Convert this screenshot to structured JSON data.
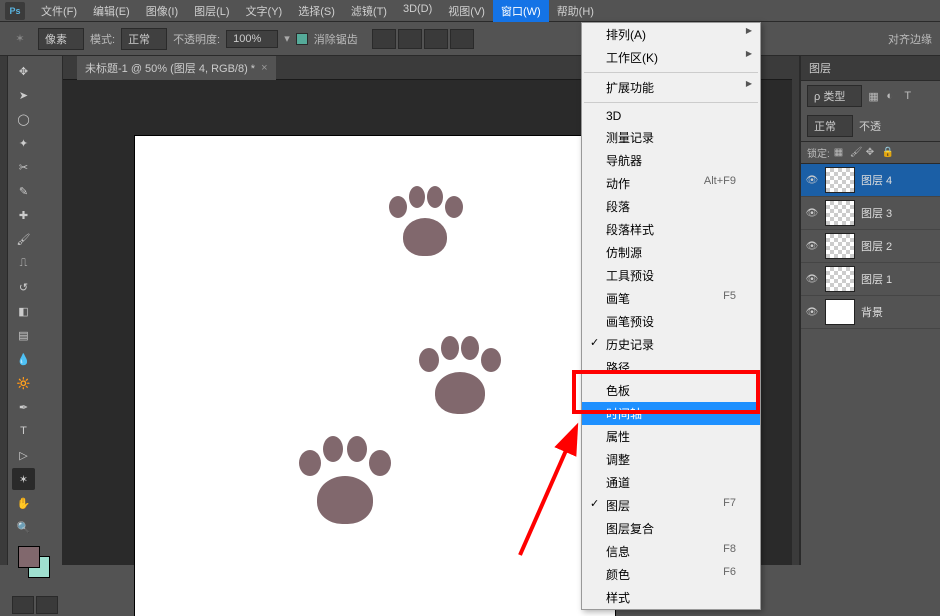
{
  "menubar": {
    "items": [
      "文件(F)",
      "编辑(E)",
      "图像(I)",
      "图层(L)",
      "文字(Y)",
      "选择(S)",
      "滤镜(T)",
      "3D(D)",
      "视图(V)",
      "窗口(W)",
      "帮助(H)"
    ],
    "active_index": 9,
    "logo_text": "Ps"
  },
  "options": {
    "unit": "像素",
    "mode_label": "模式:",
    "mode_value": "正常",
    "opacity_label": "不透明度:",
    "opacity_value": "100%",
    "antialias_label": "消除锯齿",
    "align_label": "对齐边缘"
  },
  "document": {
    "tab_title": "未标题-1 @ 50% (图层 4, RGB/8) *"
  },
  "dropdown": {
    "groups": [
      [
        {
          "label": "排列(A)",
          "sub": true
        },
        {
          "label": "工作区(K)",
          "sub": true
        }
      ],
      [
        {
          "label": "扩展功能",
          "sub": true
        }
      ],
      [
        {
          "label": "3D"
        },
        {
          "label": "测量记录"
        },
        {
          "label": "导航器"
        },
        {
          "label": "动作",
          "shortcut": "Alt+F9"
        },
        {
          "label": "段落"
        },
        {
          "label": "段落样式"
        },
        {
          "label": "仿制源"
        },
        {
          "label": "工具预设"
        },
        {
          "label": "画笔",
          "shortcut": "F5"
        },
        {
          "label": "画笔预设"
        },
        {
          "label": "历史记录",
          "checked": true
        },
        {
          "label": "路径"
        },
        {
          "label": "色板"
        },
        {
          "label": "时间轴",
          "hl": true
        },
        {
          "label": "属性"
        },
        {
          "label": "调整"
        },
        {
          "label": "通道"
        },
        {
          "label": "图层",
          "shortcut": "F7",
          "checked": true
        },
        {
          "label": "图层复合"
        },
        {
          "label": "信息",
          "shortcut": "F8"
        },
        {
          "label": "颜色",
          "shortcut": "F6"
        },
        {
          "label": "样式"
        }
      ]
    ]
  },
  "panels": {
    "layers_title": "图层",
    "filter_label": "类型",
    "blend_mode": "正常",
    "opacity_short": "不透",
    "lock_label": "锁定:",
    "layers": [
      {
        "name": "图层 4",
        "sel": true
      },
      {
        "name": "图层 3"
      },
      {
        "name": "图层 2"
      },
      {
        "name": "图层 1"
      },
      {
        "name": "背景",
        "bg": true
      }
    ]
  },
  "colors": {
    "paw": "#81686d"
  }
}
